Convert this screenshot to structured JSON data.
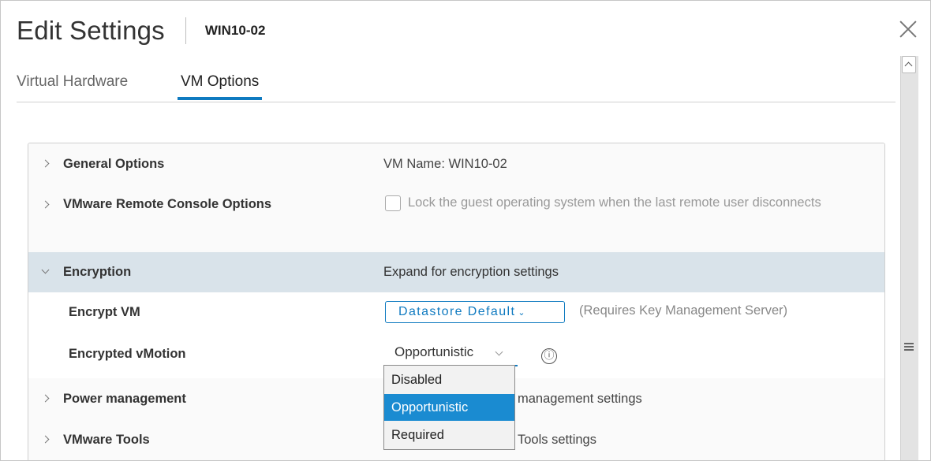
{
  "header": {
    "title": "Edit Settings",
    "subtitle": "WIN10-02"
  },
  "tabs": [
    {
      "label": "Virtual Hardware",
      "active": false
    },
    {
      "label": "VM Options",
      "active": true
    }
  ],
  "sections": {
    "general": {
      "label": "General Options",
      "value": "VM Name: WIN10-02"
    },
    "remote_console": {
      "label": "VMware Remote Console Options",
      "checkbox_label": "Lock the guest operating system when the last remote user disconnects",
      "checked": false
    },
    "encryption": {
      "label": "Encryption",
      "value": "Expand for encryption settings"
    },
    "encrypt_vm": {
      "label": "Encrypt VM",
      "button_label": "Datastore Default",
      "button_caret": "⌄",
      "note": "(Requires Key Management Server)"
    },
    "encrypted_vmotion": {
      "label": "Encrypted vMotion",
      "selected": "Opportunistic",
      "info_icon": "ⓘ"
    },
    "power": {
      "label": "Power management",
      "value_visible": "management settings"
    },
    "tools": {
      "label": "VMware Tools",
      "value_visible": "Tools settings"
    }
  },
  "dropdown": {
    "options": [
      "Disabled",
      "Opportunistic",
      "Required"
    ],
    "selected_index": 1
  },
  "colors": {
    "accent": "#0f7ac0",
    "highlight_row": "#d9e3ea",
    "selected_option": "#1a8bd1"
  }
}
